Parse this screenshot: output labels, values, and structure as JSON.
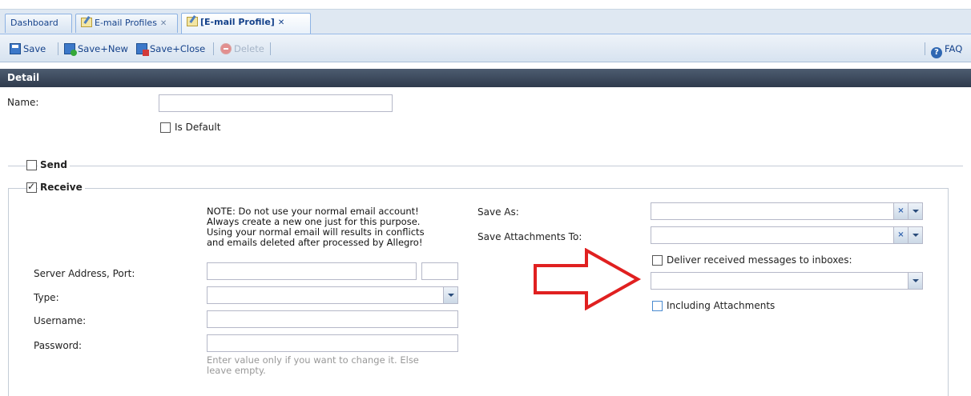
{
  "tabs": [
    {
      "label": "Dashboard",
      "has_icon": false,
      "closable": false,
      "active": false
    },
    {
      "label": "E-mail Profiles",
      "has_icon": true,
      "closable": true,
      "active": false
    },
    {
      "label": "[E-mail Profile]",
      "has_icon": true,
      "closable": true,
      "active": true
    }
  ],
  "tab_close_glyph": "✕",
  "toolbar": {
    "save_label": "Save",
    "save_new_label": "Save+New",
    "save_close_label": "Save+Close",
    "delete_label": "Delete",
    "faq_label": "FAQ"
  },
  "detail": {
    "header": "Detail",
    "name_label": "Name:",
    "name_value": "",
    "is_default_label": "Is Default",
    "is_default_checked": false
  },
  "send": {
    "legend": "Send",
    "checked": false
  },
  "receive": {
    "legend": "Receive",
    "checked": true,
    "note_lines": [
      "NOTE: Do not use your normal email account!",
      "Always create a new one just for this purpose.",
      "Using your normal email will results in conflicts",
      "and emails deleted after processed by Allegro!"
    ],
    "server_label": "Server Address, Port:",
    "server_value": "",
    "port_value": "",
    "type_label": "Type:",
    "type_value": "",
    "username_label": "Username:",
    "username_value": "",
    "password_label": "Password:",
    "password_value": "",
    "password_hint_lines": [
      "Enter value only if you want to change it. Else",
      "leave empty."
    ],
    "save_as_label": "Save As:",
    "save_as_value": "",
    "save_attachments_label": "Save Attachments To:",
    "save_attachments_value": "",
    "deliver_label": "Deliver received messages to inboxes:",
    "deliver_checked": false,
    "deliver_value": "",
    "including_attachments_label": "Including Attachments",
    "including_attachments_checked": false
  },
  "annotation_arrow_color": "#e02020"
}
